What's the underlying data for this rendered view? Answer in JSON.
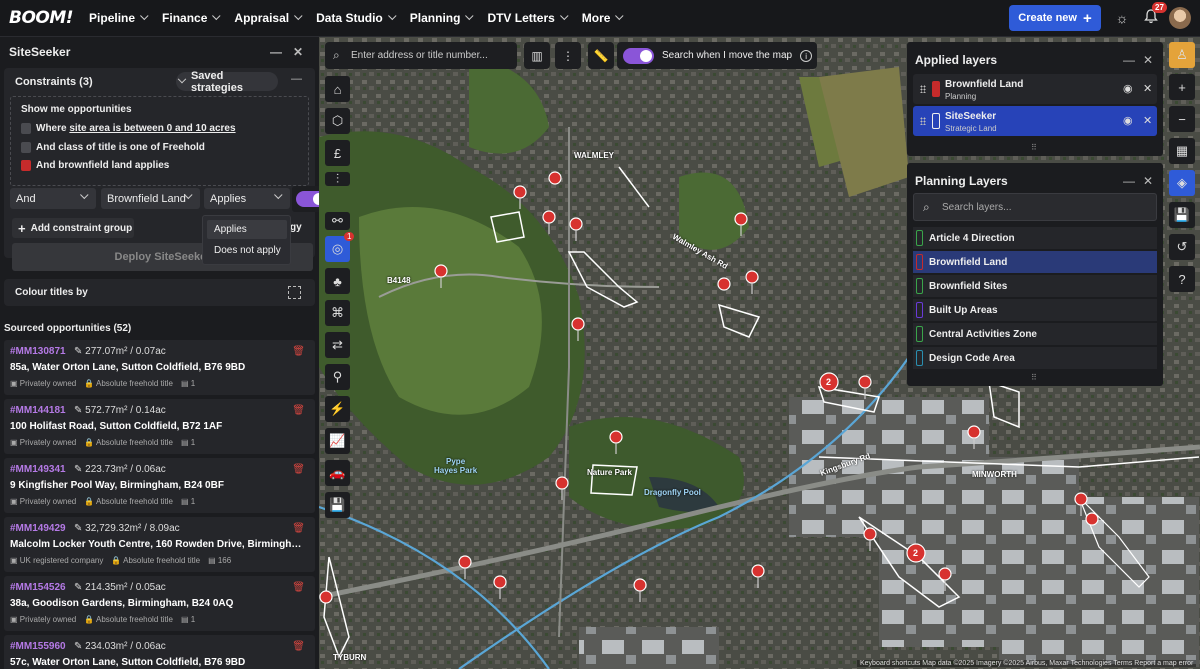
{
  "topbar": {
    "logo": "BOOM!",
    "nav": [
      "Pipeline",
      "Finance",
      "Appraisal",
      "Data Studio",
      "Planning",
      "DTV Letters",
      "More"
    ],
    "create_label": "Create new",
    "create_icon": "+",
    "notif_count": "27"
  },
  "sidebar": {
    "title": "SiteSeeker",
    "constraints_title": "Constraints (3)",
    "saved_label": "Saved strategies",
    "opps_title": "Show me opportunities",
    "rules": {
      "r1_prefix": "Where ",
      "r1_link": "site area is between 0 and 10 acres",
      "r2": "And class of title is one of Freehold",
      "r3": "And brownfield land applies"
    },
    "selects": {
      "op": "And",
      "layer": "Brownfield Land",
      "state": "Applies"
    },
    "dropdown": {
      "opt1": "Applies",
      "opt2": "Does not apply"
    },
    "add_group": "Add constraint group",
    "partial_text": "gy",
    "deploy_label": "Deploy SiteSeeker",
    "colour_label": "Colour titles by",
    "sourced_title": "Sourced opportunities (52)",
    "opportunities": [
      {
        "id": "#MM130871",
        "area": "277.07m² / 0.07ac",
        "address": "85a, Water Orton Lane, Sutton Coldfield, B76 9BD",
        "owner": "Privately owned",
        "title": "Absolute freehold title",
        "count": "1"
      },
      {
        "id": "#MM144181",
        "area": "572.77m² / 0.14ac",
        "address": "100 Holifast Road, Sutton Coldfield, B72 1AF",
        "owner": "Privately owned",
        "title": "Absolute freehold title",
        "count": "1"
      },
      {
        "id": "#MM149341",
        "area": "223.73m² / 0.06ac",
        "address": "9 Kingfisher Pool Way, Birmingham, B24 0BF",
        "owner": "Privately owned",
        "title": "Absolute freehold title",
        "count": "1"
      },
      {
        "id": "#MM149429",
        "area": "32,729.32m² / 8.09ac",
        "address": "Malcolm Locker Youth Centre, 160 Rowden Drive, Birmingham,...",
        "owner": "UK registered company",
        "title": "Absolute freehold title",
        "count": "166"
      },
      {
        "id": "#MM154526",
        "area": "214.35m² / 0.05ac",
        "address": "38a, Goodison Gardens, Birmingham, B24 0AQ",
        "owner": "Privately owned",
        "title": "Absolute freehold title",
        "count": "1"
      },
      {
        "id": "#MM155960",
        "area": "234.03m² / 0.06ac",
        "address": "57c, Water Orton Lane, Sutton Coldfield, B76 9BD",
        "owner": "",
        "title": "",
        "count": ""
      }
    ]
  },
  "map": {
    "search_placeholder": "Enter address or title number...",
    "move_label": "Search when I move the map",
    "layer_badge": "1",
    "labels": {
      "walmley": "WALMLEY",
      "pype": "Pype\nHayes Park",
      "nature": "Nature Park",
      "dragonfly": "Dragonfly Pool",
      "minworth": "MINWORTH",
      "tyburn": "TYBURN",
      "b4148": "B4148",
      "kingsbury": "Kingsbury Rd",
      "walmley_ash": "Walmley Ash Rd",
      "cluster1": "2",
      "cluster2": "2"
    },
    "attribution": "Keyboard shortcuts   Map data ©2025 Imagery ©2025 Airbus, Maxar Technologies   Terms   Report a map error"
  },
  "applied_layers": {
    "title": "Applied layers",
    "items": [
      {
        "name": "Brownfield Land",
        "sub": "Planning",
        "color": "#c62b2b"
      },
      {
        "name": "SiteSeeker",
        "sub": "Strategic Land",
        "color": "#2743b8"
      }
    ]
  },
  "planning_layers": {
    "title": "Planning Layers",
    "search_placeholder": "Search layers...",
    "items": [
      {
        "name": "Article 4 Direction",
        "color": "#3aa44a"
      },
      {
        "name": "Brownfield Land",
        "color": "#c62b2b"
      },
      {
        "name": "Brownfield Sites",
        "color": "#3aa44a"
      },
      {
        "name": "Built Up Areas",
        "color": "#6a3ad8"
      },
      {
        "name": "Central Activities Zone",
        "color": "#3aa44a"
      },
      {
        "name": "Design Code Area",
        "color": "#2a8fb0"
      }
    ]
  }
}
